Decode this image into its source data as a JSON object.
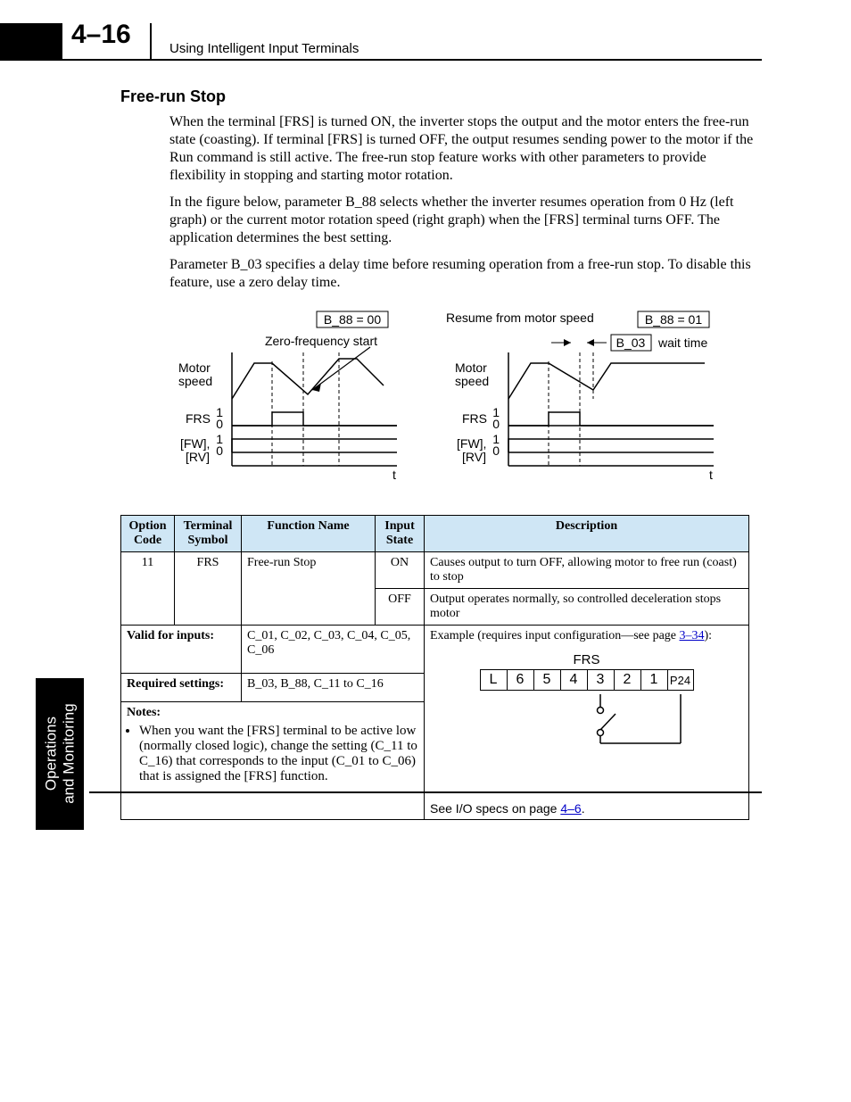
{
  "header": {
    "page_number": "4–16",
    "chapter_title": "Using Intelligent Input Terminals"
  },
  "section": {
    "title": "Free-run Stop",
    "paragraphs": [
      "When the terminal [FRS] is turned ON, the inverter stops the output and the motor enters the free-run state (coasting). If terminal [FRS] is turned OFF, the output resumes sending power to the motor if the Run command is still active. The free-run stop feature works with other parameters to provide flexibility in stopping and starting motor rotation.",
      "In the figure below, parameter B_88 selects whether the inverter resumes operation from 0 Hz (left graph) or the current motor rotation speed (right graph) when the [FRS] terminal turns OFF. The application determines the best setting.",
      "Parameter B_03 specifies a delay time before resuming operation from a free-run stop. To disable this feature, use a zero delay time."
    ]
  },
  "figure": {
    "left": {
      "param_box": "B_88 = 00",
      "subtitle": "Zero-frequency start",
      "y_labels": [
        "Motor speed",
        "FRS",
        "[FW], [RV]"
      ],
      "digital_levels": [
        "1",
        "0",
        "1",
        "0"
      ],
      "x_label": "t"
    },
    "right": {
      "heading": "Resume from motor speed",
      "param_box": "B_88 = 01",
      "wait_box": "B_03",
      "wait_label": "wait time",
      "y_labels": [
        "Motor speed",
        "FRS",
        "[FW], [RV]"
      ],
      "digital_levels": [
        "1",
        "0",
        "1",
        "0"
      ],
      "x_label": "t"
    }
  },
  "table": {
    "headers": [
      "Option Code",
      "Terminal Symbol",
      "Function Name",
      "Input State",
      "Description"
    ],
    "rows": [
      {
        "code": "11",
        "symbol": "FRS",
        "func": "Free-run Stop",
        "state": "ON",
        "desc": "Causes output to turn OFF, allowing motor to free run (coast) to stop"
      },
      {
        "code": "",
        "symbol": "",
        "func": "",
        "state": "OFF",
        "desc": "Output operates normally, so controlled deceleration stops motor"
      }
    ],
    "valid_inputs_label": "Valid for inputs:",
    "valid_inputs_value": "C_01, C_02, C_03, C_04, C_05, C_06",
    "required_label": "Required settings:",
    "required_value": "B_03, B_88, C_11 to C_16",
    "notes_label": "Notes:",
    "notes": [
      "When you want the [FRS] terminal to be active low (normally closed logic), change the setting (C_11 to C_16) that corresponds to the input (C_01 to C_06) that is assigned the [FRS] function."
    ],
    "example_text_pre": "Example (requires input configuration—see page ",
    "example_link": "3–34",
    "example_text_post": "):",
    "frs_label": "FRS",
    "terminals": [
      "L",
      "6",
      "5",
      "4",
      "3",
      "2",
      "1",
      "P24"
    ],
    "io_spec_pre": "See I/O specs on page ",
    "io_spec_link": "4–6",
    "io_spec_post": "."
  },
  "side_tab": {
    "line1": "Operations",
    "line2": "and Monitoring"
  }
}
